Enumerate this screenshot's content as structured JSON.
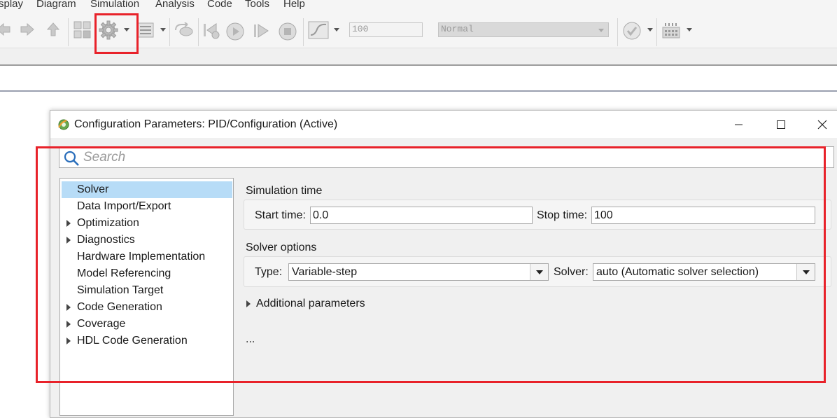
{
  "menu": {
    "items": [
      "splay",
      "Diagram",
      "Simulation",
      "Analysis",
      "Code",
      "Tools",
      "Help"
    ]
  },
  "toolbar": {
    "icons": [
      "back-arrow-icon",
      "forward-arrow-icon",
      "up-arrow-icon",
      "library-browser-icon",
      "model-settings-gear-icon",
      "model-explorer-icon",
      "record-icon",
      "step-back-icon",
      "run-icon",
      "step-forward-icon",
      "stop-icon",
      "data-inspector-icon",
      "check-icon",
      "build-icon"
    ],
    "stop_time_value": "100",
    "simulation_mode": "Normal"
  },
  "dialog": {
    "title": "Configuration Parameters: PID/Configuration (Active)",
    "search_placeholder": "Search",
    "tree": [
      {
        "label": "Solver",
        "expandable": false,
        "selected": true
      },
      {
        "label": "Data Import/Export",
        "expandable": false
      },
      {
        "label": "Optimization",
        "expandable": true
      },
      {
        "label": "Diagnostics",
        "expandable": true
      },
      {
        "label": "Hardware Implementation",
        "expandable": false
      },
      {
        "label": "Model Referencing",
        "expandable": false
      },
      {
        "label": "Simulation Target",
        "expandable": false
      },
      {
        "label": "Code Generation",
        "expandable": true
      },
      {
        "label": "Coverage",
        "expandable": true
      },
      {
        "label": "HDL Code Generation",
        "expandable": true
      }
    ],
    "simulation_time": {
      "title": "Simulation time",
      "start_label": "Start time:",
      "start_value": "0.0",
      "stop_label": "Stop time:",
      "stop_value": "100"
    },
    "solver_options": {
      "title": "Solver options",
      "type_label": "Type:",
      "type_value": "Variable-step",
      "solver_label": "Solver:",
      "solver_value": "auto (Automatic solver selection)"
    },
    "additional_parameters": "Additional parameters",
    "ellipsis": "..."
  },
  "colors": {
    "annotation_red": "#e8222a",
    "selection_blue": "#b7dcf7"
  }
}
